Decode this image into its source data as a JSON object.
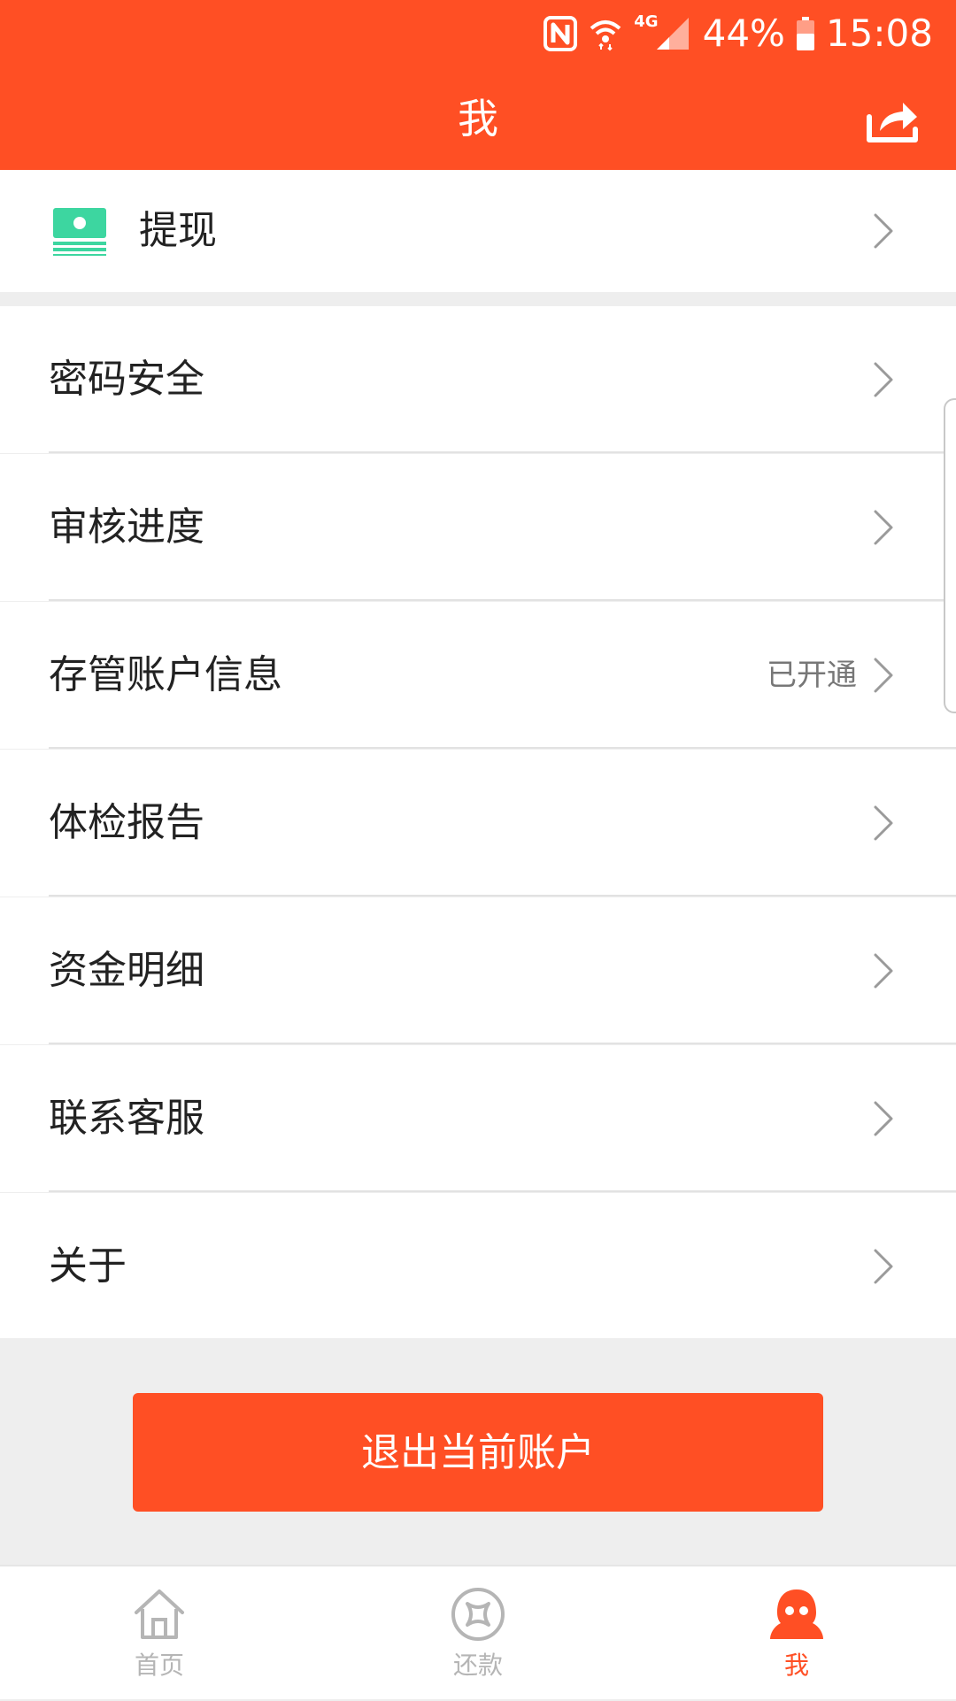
{
  "colors": {
    "accent": "#ff4f24",
    "background": "#eeeeee",
    "text": "#222222",
    "muted": "#777777",
    "tab_inactive": "#b5b5b5",
    "cash_icon": "#3dd6a0"
  },
  "status_bar": {
    "network": "4G",
    "battery": "44%",
    "time": "15:08",
    "icons": [
      "nfc-icon",
      "wifi-icon",
      "signal-icon",
      "battery-icon"
    ]
  },
  "header": {
    "title": "我",
    "share_icon": "share-icon"
  },
  "withdraw": {
    "label": "提现",
    "icon": "cash-icon"
  },
  "menu": {
    "items": [
      {
        "label": "密码安全",
        "meta": ""
      },
      {
        "label": "审核进度",
        "meta": ""
      },
      {
        "label": "存管账户信息",
        "meta": "已开通"
      },
      {
        "label": "体检报告",
        "meta": ""
      },
      {
        "label": "资金明细",
        "meta": ""
      },
      {
        "label": "联系客服",
        "meta": ""
      },
      {
        "label": "关于",
        "meta": ""
      }
    ]
  },
  "logout": {
    "label": "退出当前账户"
  },
  "tabbar": {
    "tabs": [
      {
        "label": "首页",
        "icon": "home-icon",
        "active": false
      },
      {
        "label": "还款",
        "icon": "repay-icon",
        "active": false
      },
      {
        "label": "我",
        "icon": "profile-icon",
        "active": true
      }
    ]
  }
}
